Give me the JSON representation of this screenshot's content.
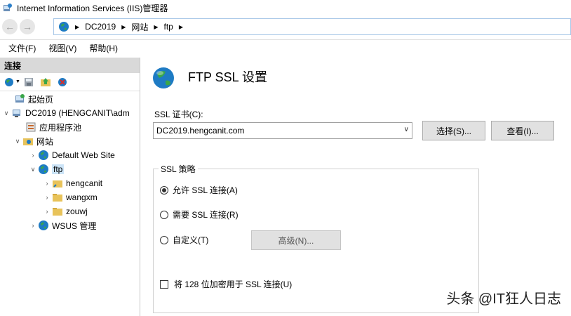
{
  "window": {
    "title": "Internet Information Services (IIS)管理器"
  },
  "address": {
    "segments": [
      "DC2019",
      "网站",
      "ftp"
    ]
  },
  "menu": {
    "items": [
      "文件(F)",
      "视图(V)",
      "帮助(H)"
    ]
  },
  "connections": {
    "header": "连接",
    "tree": [
      {
        "label": "起始页"
      },
      {
        "label": "DC2019 (HENGCANIT\\adm"
      },
      {
        "label": "应用程序池"
      },
      {
        "label": "网站"
      },
      {
        "label": "Default Web Site"
      },
      {
        "label": "ftp"
      },
      {
        "label": "hengcanit"
      },
      {
        "label": "wangxm"
      },
      {
        "label": "zouwj"
      },
      {
        "label": "WSUS 管理"
      }
    ]
  },
  "panel": {
    "title": "FTP SSL 设置",
    "ssl_cert_label": "SSL 证书(C):",
    "ssl_cert_value": "DC2019.hengcanit.com",
    "select_button": "选择(S)...",
    "view_button": "查看(I)...",
    "policy_legend": "SSL 策略",
    "options": {
      "allow": "允许 SSL 连接(A)",
      "require": "需要 SSL 连接(R)",
      "custom": "自定义(T)"
    },
    "selected_option": "allow",
    "advanced_button": "高级(N)...",
    "encrypt128_label": "将 128 位加密用于 SSL 连接(U)",
    "encrypt128_checked": false
  },
  "watermark": "头条 @IT狂人日志"
}
